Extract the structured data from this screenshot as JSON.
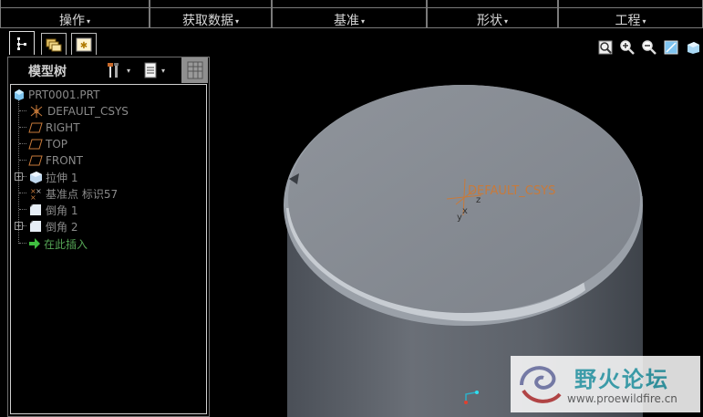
{
  "menubar": {
    "items": [
      {
        "label": "操作"
      },
      {
        "label": "获取数据"
      },
      {
        "label": "基准"
      },
      {
        "label": "形状"
      },
      {
        "label": "工程"
      }
    ],
    "caret": "▾"
  },
  "tabs": [
    {
      "icon": "model-tree-icon",
      "active": true
    },
    {
      "icon": "folder-browser-icon",
      "active": false
    },
    {
      "icon": "favorites-icon",
      "active": false
    }
  ],
  "model_tree": {
    "title": "模型树",
    "nodes": [
      {
        "label": "PRT0001.PRT",
        "icon": "part-icon",
        "style": "dim"
      },
      {
        "label": "DEFAULT_CSYS",
        "icon": "csys-icon",
        "style": "dim"
      },
      {
        "label": "RIGHT",
        "icon": "datum-plane-icon",
        "style": "dim"
      },
      {
        "label": "TOP",
        "icon": "datum-plane-icon",
        "style": "dim"
      },
      {
        "label": "FRONT",
        "icon": "datum-plane-icon",
        "style": "dim"
      },
      {
        "label": "拉伸 1",
        "icon": "extrude-icon",
        "style": "dim",
        "expandable": true
      },
      {
        "label": "基准点 标识57",
        "icon": "datum-point-icon",
        "style": "dim"
      },
      {
        "label": "倒角 1",
        "icon": "chamfer-icon",
        "style": "dim"
      },
      {
        "label": "倒角 2",
        "icon": "chamfer-icon",
        "style": "dim",
        "expandable": true
      },
      {
        "label": "在此插入",
        "icon": "insert-here-arrow-icon",
        "style": "grn"
      }
    ]
  },
  "viewport": {
    "csys_label": "DEFAULT_CSYS",
    "axis_labels": {
      "x": "x",
      "y": "y",
      "z": "z"
    },
    "tools": [
      "zoom-window-icon",
      "zoom-in-icon",
      "zoom-out-icon",
      "refit-icon",
      "repaint-icon"
    ]
  },
  "watermark": {
    "title": "野火论坛",
    "url": "www.proewildfire.cn"
  },
  "colors": {
    "background": "#000000",
    "model_top": "#8a8f96",
    "model_side": "#5b6068",
    "csys": "#c87a3a",
    "tree_text": "#8a8a8a",
    "insert_here": "#55a555",
    "watermark_title": "#3aa9b7"
  }
}
